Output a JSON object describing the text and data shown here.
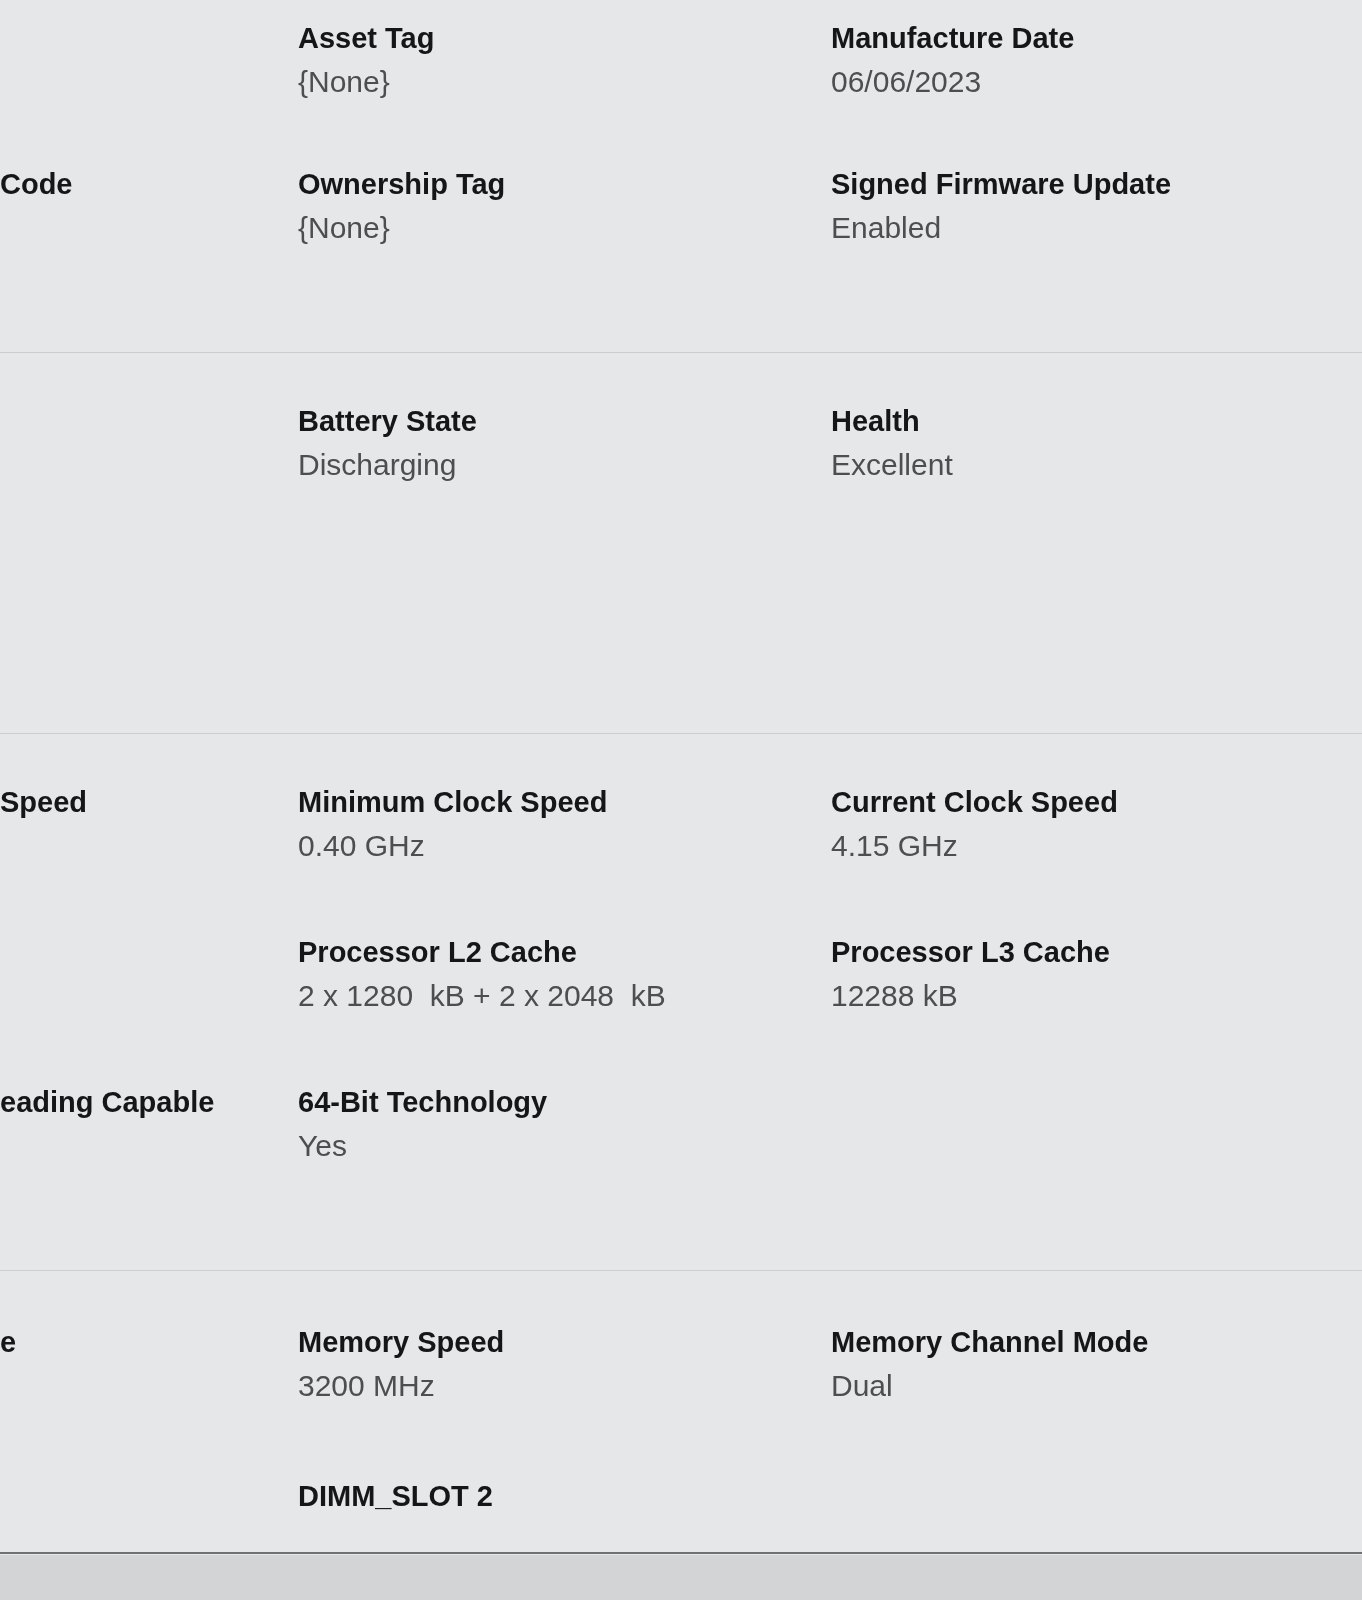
{
  "sections": [
    {
      "rows": [
        {
          "column_2": {
            "label": "Asset Tag",
            "value": "{None}"
          },
          "column_3": {
            "label": "Manufacture Date",
            "value": "06/06/2023"
          }
        },
        {
          "column_1": {
            "label": "Code"
          },
          "column_2": {
            "label": "Ownership Tag",
            "value": "{None}"
          },
          "column_3": {
            "label": "Signed Firmware Update",
            "value": "Enabled"
          }
        }
      ]
    },
    {
      "rows": [
        {
          "column_2": {
            "label": "Battery State",
            "value": "Discharging"
          },
          "column_3": {
            "label": "Health",
            "value": "Excellent"
          }
        }
      ]
    },
    {
      "rows": [
        {
          "column_1": {
            "label": "Speed"
          },
          "column_2": {
            "label": "Minimum Clock Speed",
            "value": "0.40 GHz"
          },
          "column_3": {
            "label": "Current Clock Speed",
            "value": "4.15 GHz"
          }
        },
        {
          "column_2": {
            "label": "Processor L2 Cache",
            "value": "2 x 1280  kB + 2 x 2048  kB"
          },
          "column_3": {
            "label": "Processor L3 Cache",
            "value": "12288 kB"
          }
        },
        {
          "column_1": {
            "label": "eading Capable"
          },
          "column_2": {
            "label": "64-Bit Technology",
            "value": "Yes"
          }
        }
      ]
    },
    {
      "rows": [
        {
          "column_1": {
            "label": "e"
          },
          "column_2": {
            "label": "Memory Speed",
            "value": "3200 MHz"
          },
          "column_3": {
            "label": "Memory Channel Mode",
            "value": "Dual"
          }
        },
        {
          "column_2": {
            "label": "DIMM_SLOT 2"
          }
        }
      ]
    }
  ]
}
